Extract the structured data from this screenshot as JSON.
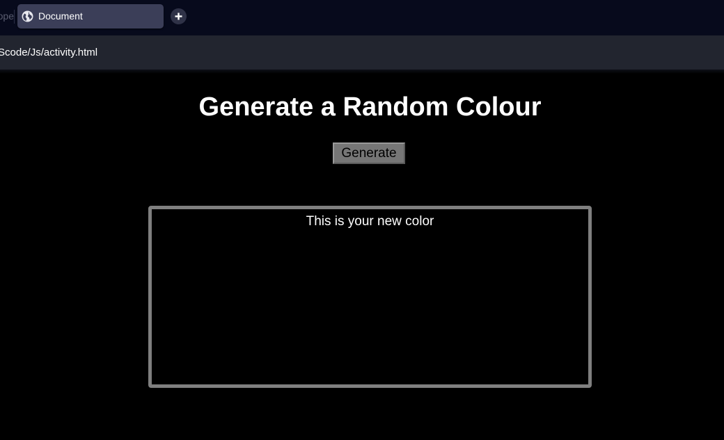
{
  "browser": {
    "previous_tab_fragment": "ope",
    "active_tab": {
      "title": "Document",
      "icon": "globe-icon"
    },
    "new_tab_icon": "plus-icon",
    "address": "Scode/Js/activity.html"
  },
  "page": {
    "heading": "Generate a Random Colour",
    "generate_button_label": "Generate",
    "color_box_text": "This is your new color"
  },
  "colors": {
    "tab_bar_bg": "#070a1c",
    "active_tab_bg": "#3b3e58",
    "address_bar_bg": "#22252f",
    "page_bg": "#000000",
    "button_bg": "#767676",
    "box_border": "#7f7f7f"
  }
}
